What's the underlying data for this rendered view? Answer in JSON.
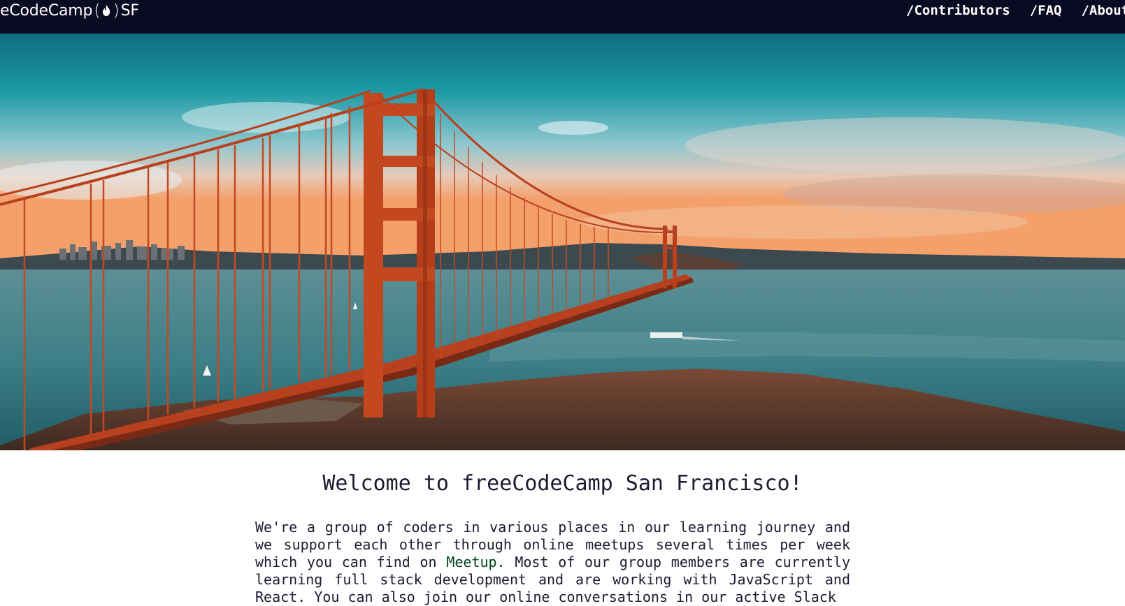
{
  "header": {
    "brand": {
      "text_left": "eCodeCamp",
      "paren_open": "(",
      "paren_close": ")",
      "text_right": "SF"
    },
    "nav": [
      {
        "label": "/Contributors"
      },
      {
        "label": "/FAQ"
      },
      {
        "label": "/About"
      }
    ]
  },
  "hero": {
    "image": "golden-gate-bridge-photo"
  },
  "main": {
    "title": "Welcome to freeCodeCamp San Francisco!",
    "intro": {
      "part1": "We're a group of coders in various places in our learning journey and we support each other through online meetups several times per week which you can find on ",
      "meetup_link": "Meetup.",
      "part2": " Most of our group members are currently learning full stack development and are working with JavaScript and React. You can also join our online conversations in our active Slack"
    }
  },
  "colors": {
    "topbar_bg": "#0a0a23",
    "link_green": "#00471b",
    "text": "#1b1b32"
  }
}
